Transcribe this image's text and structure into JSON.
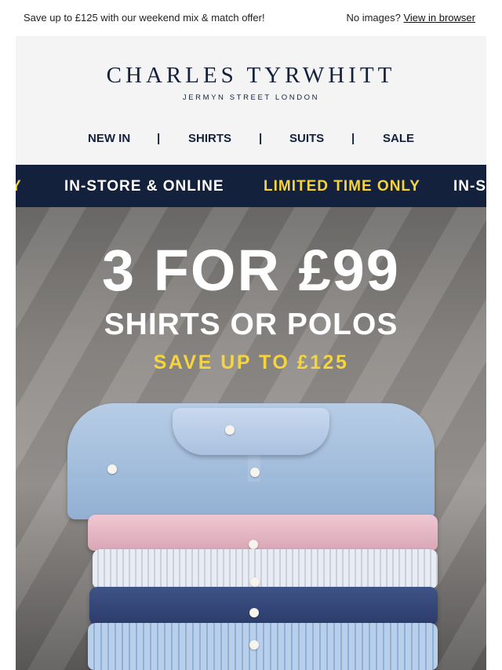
{
  "preheader": {
    "offer_text": "Save up to £125 with our weekend mix & match offer!",
    "no_images_text": "No images?",
    "view_in_browser_label": "View in browser"
  },
  "brand": {
    "name": "CHARLES TYRWHITT",
    "tagline": "JERMYN STREET LONDON",
    "color": "#14213d"
  },
  "nav": {
    "items": [
      "NEW IN",
      "SHIRTS",
      "SUITS",
      "SALE"
    ],
    "separator": "|"
  },
  "ticker": {
    "items": [
      "Y",
      "IN-STORE & ONLINE",
      "LIMITED TIME ONLY",
      "IN-S"
    ],
    "background": "#14213d",
    "highlight_color": "#f6d43c"
  },
  "hero": {
    "headline": "3 FOR £99",
    "subheadline": "SHIRTS OR POLOS",
    "savings": "SAVE UP TO £125",
    "savings_color": "#f6d43c"
  }
}
